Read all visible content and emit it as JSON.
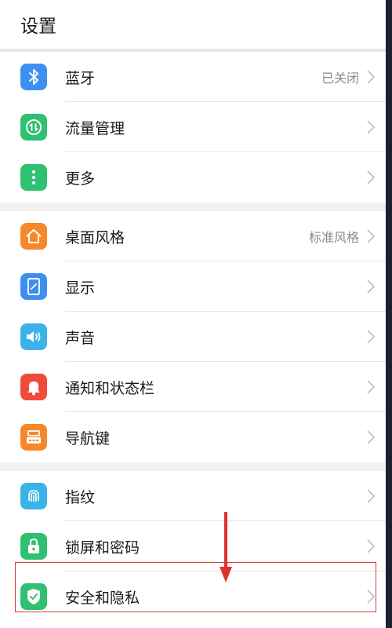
{
  "header": {
    "title": "设置"
  },
  "groups": [
    {
      "items": [
        {
          "label": "蓝牙",
          "value": "已关闭",
          "icon": "bluetooth-icon",
          "color": "#3d8ff0"
        },
        {
          "label": "流量管理",
          "value": "",
          "icon": "data-traffic-icon",
          "color": "#2fc071"
        },
        {
          "label": "更多",
          "value": "",
          "icon": "more-icon",
          "color": "#2fc071"
        }
      ]
    },
    {
      "items": [
        {
          "label": "桌面风格",
          "value": "标准风格",
          "icon": "home-icon",
          "color": "#f5882a"
        },
        {
          "label": "显示",
          "value": "",
          "icon": "display-icon",
          "color": "#3d8ff0"
        },
        {
          "label": "声音",
          "value": "",
          "icon": "sound-icon",
          "color": "#3ab3e8"
        },
        {
          "label": "通知和状态栏",
          "value": "",
          "icon": "notification-bell-icon",
          "color": "#f04a3a"
        },
        {
          "label": "导航键",
          "value": "",
          "icon": "navigation-key-icon",
          "color": "#f5882a"
        }
      ]
    },
    {
      "items": [
        {
          "label": "指纹",
          "value": "",
          "icon": "fingerprint-icon",
          "color": "#3ab3e8"
        },
        {
          "label": "锁屏和密码",
          "value": "",
          "icon": "lock-icon",
          "color": "#2fc071"
        },
        {
          "label": "安全和隐私",
          "value": "",
          "icon": "shield-icon",
          "color": "#2fc071"
        }
      ]
    }
  ],
  "annotation": {
    "highlight_color": "#d93a3a",
    "arrow_color": "#e0312e"
  }
}
